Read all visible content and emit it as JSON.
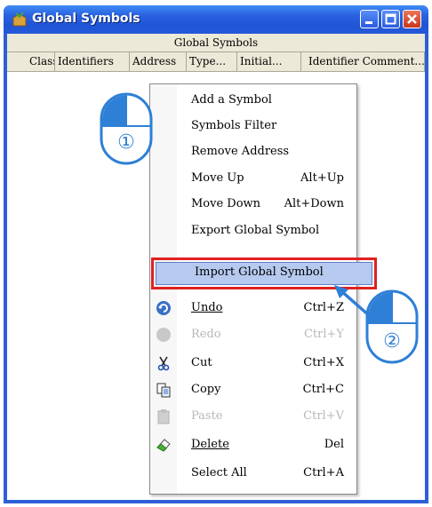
{
  "window": {
    "title": "Global Symbols"
  },
  "header": {
    "group_label": "Global Symbols",
    "columns": [
      "Class",
      "Identifiers",
      "Address",
      "Type...",
      "Initial...",
      "Identifier Comment..."
    ]
  },
  "menu": {
    "items": [
      {
        "label": "Add a Symbol",
        "shortcut": "",
        "icon": "",
        "enabled": true
      },
      {
        "label": "Symbols Filter",
        "shortcut": "",
        "icon": "",
        "enabled": true
      },
      {
        "label": "Remove Address",
        "shortcut": "",
        "icon": "",
        "enabled": true
      },
      {
        "label": "Move Up",
        "shortcut": "Alt+Up",
        "icon": "",
        "enabled": true
      },
      {
        "label": "Move Down",
        "shortcut": "Alt+Down",
        "icon": "",
        "enabled": true
      },
      {
        "label": "Export Global Symbol",
        "shortcut": "",
        "icon": "",
        "enabled": true
      },
      {
        "label": "Import Global Symbol",
        "shortcut": "",
        "icon": "",
        "enabled": true,
        "highlighted": true
      },
      {
        "label": "Undo",
        "shortcut": "Ctrl+Z",
        "icon": "undo-icon",
        "enabled": true
      },
      {
        "label": "Redo",
        "shortcut": "Ctrl+Y",
        "icon": "redo-icon",
        "enabled": false
      },
      {
        "label": "Cut",
        "shortcut": "Ctrl+X",
        "icon": "cut-icon",
        "enabled": true
      },
      {
        "label": "Copy",
        "shortcut": "Ctrl+C",
        "icon": "copy-icon",
        "enabled": true
      },
      {
        "label": "Paste",
        "shortcut": "Ctrl+V",
        "icon": "paste-icon",
        "enabled": false
      },
      {
        "label": "Delete",
        "shortcut": "Del",
        "icon": "delete-icon",
        "enabled": true
      },
      {
        "label": "Select All",
        "shortcut": "Ctrl+A",
        "icon": "",
        "enabled": true
      }
    ]
  },
  "annotations": {
    "step1": "①",
    "step2": "②"
  },
  "colors": {
    "highlight_border": "#e12020",
    "mouse_blue": "#2e7fd6",
    "titlebar": "#2a62e0"
  }
}
